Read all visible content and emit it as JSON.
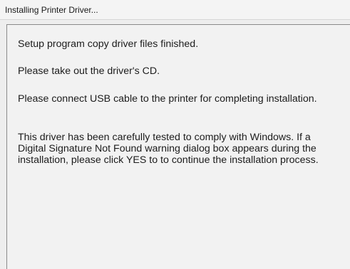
{
  "window": {
    "title": "Installing Printer Driver..."
  },
  "messages": [
    "Setup program copy driver files finished.",
    "Please take out the driver's CD.",
    "Please connect USB cable to the printer for completing installation.",
    "This driver has been carefully tested to comply with Windows. If a Digital Signature Not Found warning dialog box appears during the installation, please click YES to to continue the installation process."
  ]
}
